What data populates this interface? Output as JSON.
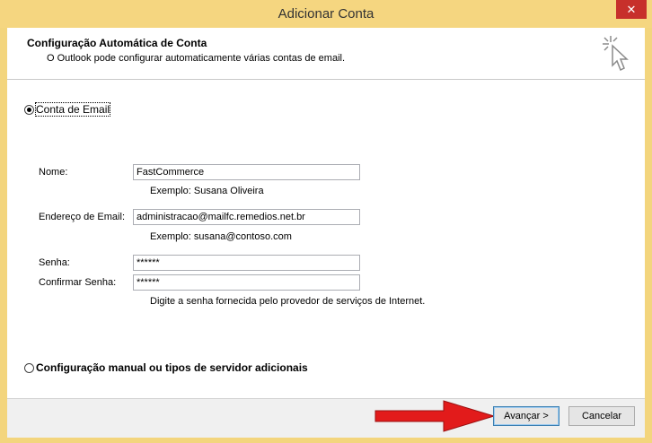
{
  "window": {
    "title": "Adicionar Conta",
    "close_glyph": "✕"
  },
  "header": {
    "title": "Configuração Automática de Conta",
    "subtitle": "O Outlook pode configurar automaticamente várias contas de email.",
    "icon": "wizard-cursor-icon"
  },
  "form": {
    "email_account_option": "Conta de Email",
    "name_label": "Nome:",
    "name_value": "FastCommerce",
    "name_hint": "Exemplo: Susana Oliveira",
    "email_label": "Endereço de Email:",
    "email_value": "administracao@mailfc.remedios.net.br",
    "email_hint": "Exemplo: susana@contoso.com",
    "password_label": "Senha:",
    "password_value": "******",
    "confirm_label": "Confirmar Senha:",
    "confirm_value": "******",
    "password_hint": "Digite a senha fornecida pelo provedor de serviços de Internet.",
    "manual_option": "Configuração manual ou tipos de servidor adicionais"
  },
  "footer": {
    "next_label": "Avançar >",
    "cancel_label": "Cancelar"
  },
  "colors": {
    "titlebar": "#f5d680",
    "close": "#c7302b",
    "arrow": "#e21b1b"
  }
}
